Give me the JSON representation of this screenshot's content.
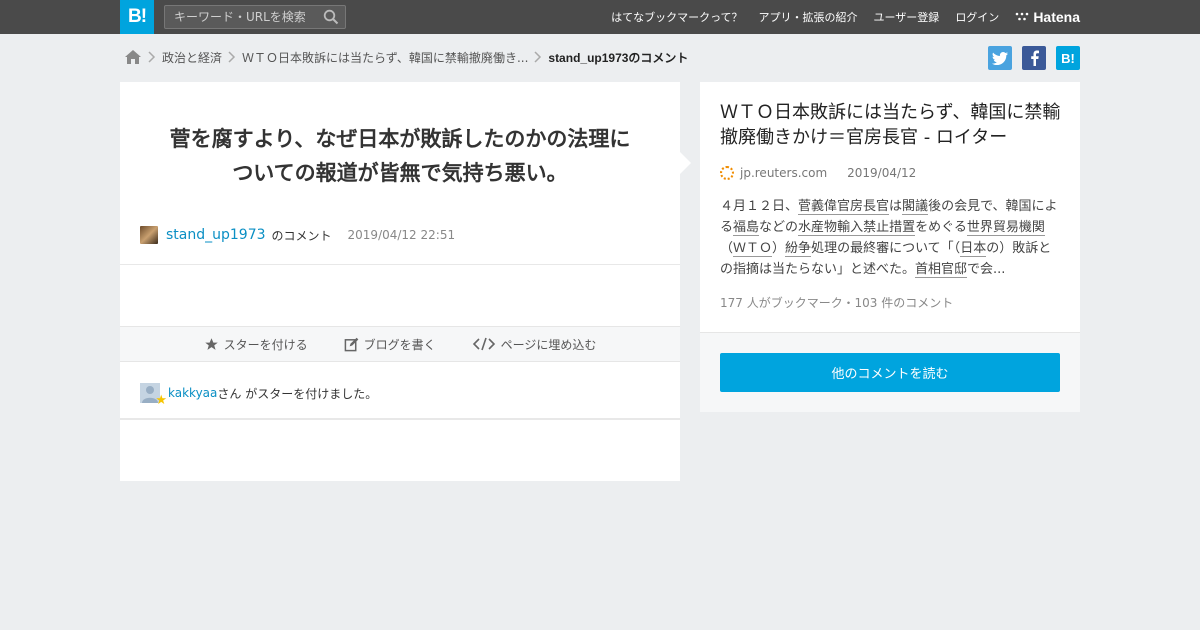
{
  "header": {
    "logo": "B!",
    "search_placeholder": "キーワード・URLを検索",
    "nav": [
      "はてなブックマークって？",
      "アプリ・拡張の紹介",
      "ユーザー登録",
      "ログイン"
    ],
    "brand": "Hatena"
  },
  "breadcrumb": {
    "category": "政治と経済",
    "entry": "ＷＴＯ日本敗訴には当たらず、韓国に禁輸撤廃働き...",
    "current": "stand_up1973のコメント"
  },
  "comment": {
    "text_line1": "菅を腐すより、なぜ日本が敗訴したのかの法理に",
    "text_line2": "ついての報道が皆無で気持ち悪い。",
    "username": "stand_up1973",
    "suffix": "のコメント",
    "timestamp": "2019/04/12 22:51"
  },
  "actions": {
    "star": "スターを付ける",
    "blog": "ブログを書く",
    "embed": "ページに埋め込む"
  },
  "star_notice": {
    "user": "kakkyaa",
    "text": "さん がスターを付けました。"
  },
  "entry": {
    "title": "ＷＴＯ日本敗訴には当たらず、韓国に禁輸撤廃働きかけ＝官房長官 - ロイター",
    "site": "jp.reuters.com",
    "date": "2019/04/12",
    "summary_parts": [
      "４月１２日、",
      "菅義偉官房長官",
      "は",
      "閣議",
      "後の会見で、韓国による",
      "福島",
      "などの",
      "水産物",
      "輸入禁止措置",
      "をめぐる",
      "世界貿易機関",
      "（",
      "ＷＴＯ",
      "）",
      "紛争",
      "処理の最終審について「（",
      "日本",
      "の）敗訴との指摘は当たらない」と述べた。",
      "首相官邸",
      "で会..."
    ],
    "counts": "177 人がブックマーク・103 件のコメント",
    "read_more": "他のコメントを読む"
  },
  "colors": {
    "header_bg": "#4a4a4a",
    "brand_blue": "#00a4de",
    "link_blue": "#0a8fc4",
    "twitter": "#4aa3df",
    "facebook": "#3b5998"
  }
}
